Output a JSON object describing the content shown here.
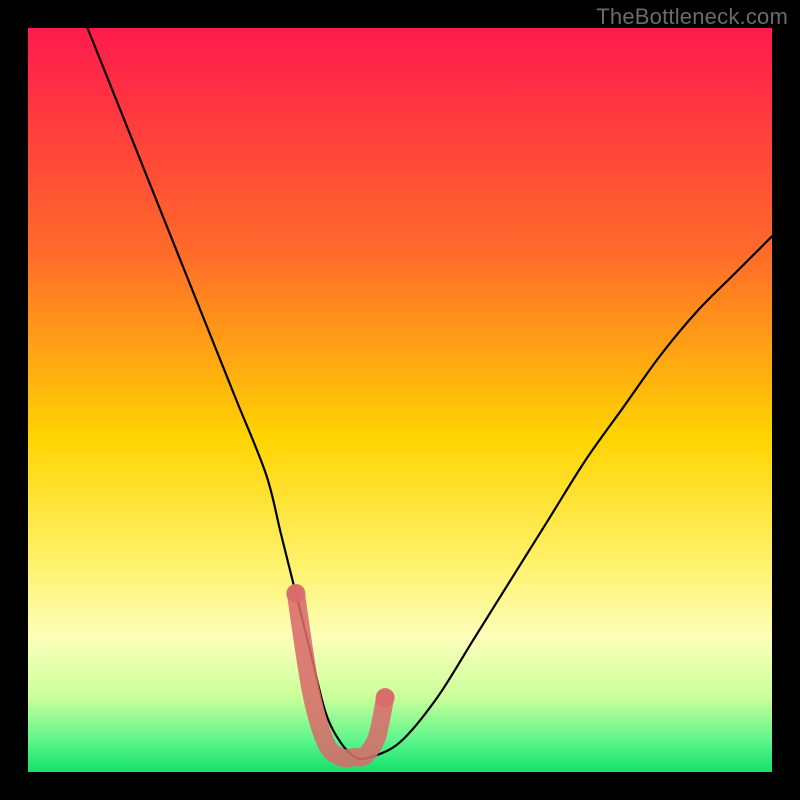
{
  "watermark": "TheBottleneck.com",
  "chart_data": {
    "type": "line",
    "title": "",
    "xlabel": "",
    "ylabel": "",
    "xlim": [
      0,
      100
    ],
    "ylim": [
      0,
      100
    ],
    "series": [
      {
        "name": "curve",
        "x": [
          8,
          12,
          16,
          20,
          24,
          28,
          32,
          34,
          36,
          38,
          40,
          42,
          44,
          46,
          50,
          55,
          60,
          65,
          70,
          75,
          80,
          85,
          90,
          95,
          100
        ],
        "y": [
          100,
          90,
          80,
          70,
          60,
          50,
          40,
          32,
          24,
          16,
          8,
          4,
          2,
          2,
          4,
          10,
          18,
          26,
          34,
          42,
          49,
          56,
          62,
          67,
          72
        ]
      },
      {
        "name": "highlight",
        "x": [
          36,
          38,
          40,
          42,
          44,
          45,
          46,
          47,
          48
        ],
        "y": [
          24,
          11,
          4,
          2,
          2,
          2,
          3,
          5,
          10
        ]
      }
    ],
    "gradient_stops": [
      {
        "offset": 0.0,
        "color": "#ff1a4d"
      },
      {
        "offset": 0.3,
        "color": "#ff6a2a"
      },
      {
        "offset": 0.55,
        "color": "#ffd400"
      },
      {
        "offset": 0.72,
        "color": "#fff26b"
      },
      {
        "offset": 0.82,
        "color": "#fdffba"
      },
      {
        "offset": 0.9,
        "color": "#c9ff9a"
      },
      {
        "offset": 0.96,
        "color": "#58f58a"
      },
      {
        "offset": 1.0,
        "color": "#15e06b"
      }
    ],
    "highlight_color": "#d86b6b",
    "curve_color": "#000000"
  }
}
